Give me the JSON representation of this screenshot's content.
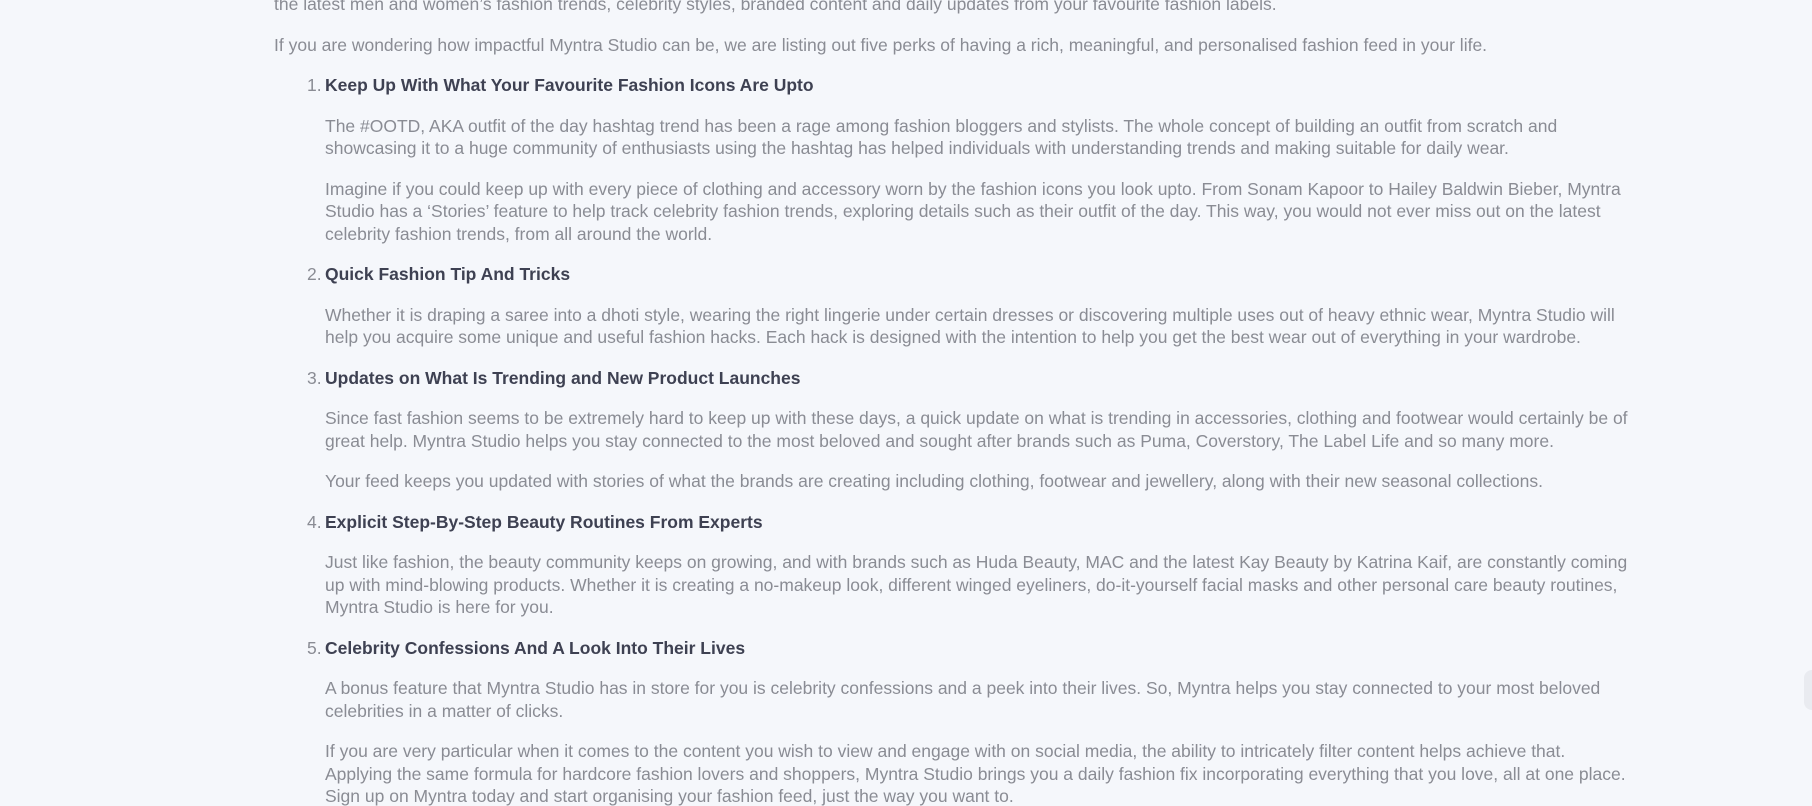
{
  "article": {
    "intro": [
      "the latest men and women’s fashion trends, celebrity styles, branded content and daily updates from your favourite fashion labels.",
      "If you are wondering how impactful Myntra Studio can be, we are listing out five perks of having a rich, meaningful, and personalised fashion feed in your life."
    ],
    "perks": [
      {
        "number": "1.",
        "title": "Keep Up With What Your Favourite Fashion Icons Are Upto",
        "paragraphs": [
          "The #OOTD, AKA outfit of the day hashtag trend has been a rage among fashion bloggers and stylists. The whole concept of building an outfit from scratch and showcasing it to a huge community of enthusiasts using the hashtag has helped individuals with understanding trends and making suitable for daily wear.",
          "Imagine if you could keep up with every piece of clothing and accessory worn by the fashion icons you look upto. From Sonam Kapoor to Hailey Baldwin Bieber, Myntra Studio has a ‘Stories’ feature to help track celebrity fashion trends, exploring details such as their outfit of the day. This way, you would not ever miss out on the latest celebrity fashion trends, from all around the world."
        ]
      },
      {
        "number": "2.",
        "title": "Quick Fashion Tip And Tricks",
        "paragraphs": [
          "Whether it is draping a saree into a dhoti style, wearing the right lingerie under certain dresses or discovering multiple uses out of heavy ethnic wear, Myntra Studio will help you acquire some unique and useful fashion hacks. Each hack is designed with the intention to help you get the best wear out of everything in your wardrobe."
        ]
      },
      {
        "number": "3.",
        "title": "Updates on What Is Trending and New Product Launches",
        "paragraphs": [
          "Since fast fashion seems to be extremely hard to keep up with these days, a quick update on what is trending in accessories, clothing and footwear would certainly be of great help. Myntra Studio helps you stay connected to the most beloved and sought after brands such as Puma, Coverstory, The Label Life and so many more.",
          "Your feed keeps you updated with stories of what the brands are creating including clothing, footwear and jewellery, along with their new seasonal collections."
        ]
      },
      {
        "number": "4.",
        "title": "Explicit Step-By-Step Beauty Routines From Experts",
        "paragraphs": [
          "Just like fashion, the beauty community keeps on growing, and with brands such as Huda Beauty, MAC and the latest Kay Beauty by Katrina Kaif, are constantly coming up with mind-blowing products. Whether it is creating a no-makeup look, different winged eyeliners, do-it-yourself facial masks and other personal care beauty routines, Myntra Studio is here for you."
        ]
      },
      {
        "number": "5.",
        "title": "Celebrity Confessions And A Look Into Their Lives",
        "paragraphs": [
          "A bonus feature that Myntra Studio has in store for you is celebrity confessions and a peek into their lives. So, Myntra helps you stay connected to your most beloved celebrities in a matter of clicks.",
          "If you are very particular when it comes to the content you wish to view and engage with on social media, the ability to intricately filter content helps achieve that. Applying the same formula for hardcore fashion lovers and shoppers, Myntra Studio brings you a daily fashion fix incorporating everything that you love, all at one place. Sign up on Myntra today and start organising your fashion feed, just the way you want to."
        ]
      }
    ]
  },
  "colors": {
    "background": "#f5f7fb",
    "body_text": "#8a8c94",
    "heading_text": "#3e4152"
  }
}
